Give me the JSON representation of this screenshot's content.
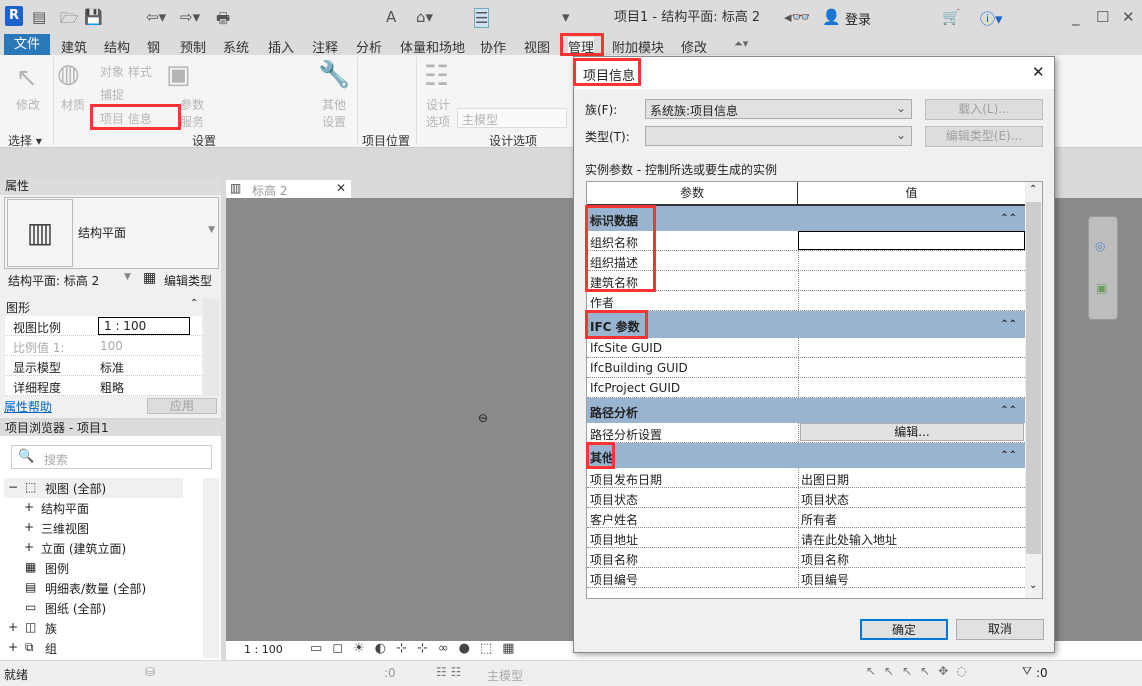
{
  "app": {
    "logo": "R",
    "title": "项目1 - 结构平面: 标高 2",
    "login": "登录"
  },
  "tabs": [
    "文件",
    "建筑",
    "结构",
    "钢",
    "预制",
    "系统",
    "插入",
    "注释",
    "分析",
    "体量和场地",
    "协作",
    "视图",
    "管理",
    "附加模块",
    "修改"
  ],
  "ribbon": {
    "modify": "修改",
    "material": "材质",
    "object_styles": "对象 样式",
    "snap": "捕捉",
    "project_info": "项目 信息",
    "params_service": "参数 服务",
    "other_settings": "其他 设置",
    "design_options": "设计 选项",
    "main_model": "主模型",
    "panels": {
      "select": "选择 ▾",
      "settings": "设置",
      "location": "项目位置",
      "design_options": "设计选项"
    }
  },
  "properties": {
    "header": "属性",
    "type_name": "结构平面",
    "instance": "结构平面: 标高 2",
    "edit_type": "编辑类型",
    "group": "图形",
    "rows": [
      {
        "k": "视图比例",
        "v": "1 : 100"
      },
      {
        "k": "比例值 1:",
        "v": "100"
      },
      {
        "k": "显示模型",
        "v": "标准"
      },
      {
        "k": "详细程度",
        "v": "粗略"
      }
    ],
    "help": "属性帮助",
    "apply": "应用"
  },
  "browser": {
    "header": "项目浏览器 - 项目1",
    "search_placeholder": "搜索",
    "items": [
      "视图 (全部)",
      "结构平面",
      "三维视图",
      "立面 (建筑立面)",
      "图例",
      "明细表/数量 (全部)",
      "图纸 (全部)",
      "族",
      "组"
    ]
  },
  "view": {
    "tab": "标高 2",
    "scale": "1 : 100"
  },
  "status": {
    "ready": "就绪",
    "count": ":0",
    "model": "主模型",
    "filter_count": ":0"
  },
  "dialog": {
    "title": "项目信息",
    "family_label": "族(F):",
    "family_value": "系统族:项目信息",
    "load": "载入(L)...",
    "type_label": "类型(T):",
    "edit_type": "编辑类型(E)...",
    "instance_caption": "实例参数 - 控制所选或要生成的实例",
    "col_param": "参数",
    "col_value": "值",
    "groups": [
      {
        "name": "标识数据",
        "rows": [
          {
            "p": "组织名称",
            "v": ""
          },
          {
            "p": "组织描述",
            "v": ""
          },
          {
            "p": "建筑名称",
            "v": ""
          },
          {
            "p": "作者",
            "v": ""
          }
        ]
      },
      {
        "name": "IFC 参数",
        "rows": [
          {
            "p": "IfcSite GUID",
            "v": ""
          },
          {
            "p": "IfcBuilding GUID",
            "v": ""
          },
          {
            "p": "IfcProject GUID",
            "v": ""
          }
        ]
      },
      {
        "name": "路径分析",
        "rows": [
          {
            "p": "路径分析设置",
            "v": "编辑...",
            "button": true
          }
        ]
      },
      {
        "name": "其他",
        "rows": [
          {
            "p": "项目发布日期",
            "v": "出图日期"
          },
          {
            "p": "项目状态",
            "v": "项目状态"
          },
          {
            "p": "客户姓名",
            "v": "所有者"
          },
          {
            "p": "项目地址",
            "v": "请在此处输入地址"
          },
          {
            "p": "项目名称",
            "v": "项目名称"
          },
          {
            "p": "项目编号",
            "v": "项目编号"
          }
        ]
      }
    ],
    "ok": "确定",
    "cancel": "取消"
  },
  "colors": {
    "accent": "#2b78b8",
    "highlight": "#ff3333",
    "group_header": "#99b4d1"
  }
}
